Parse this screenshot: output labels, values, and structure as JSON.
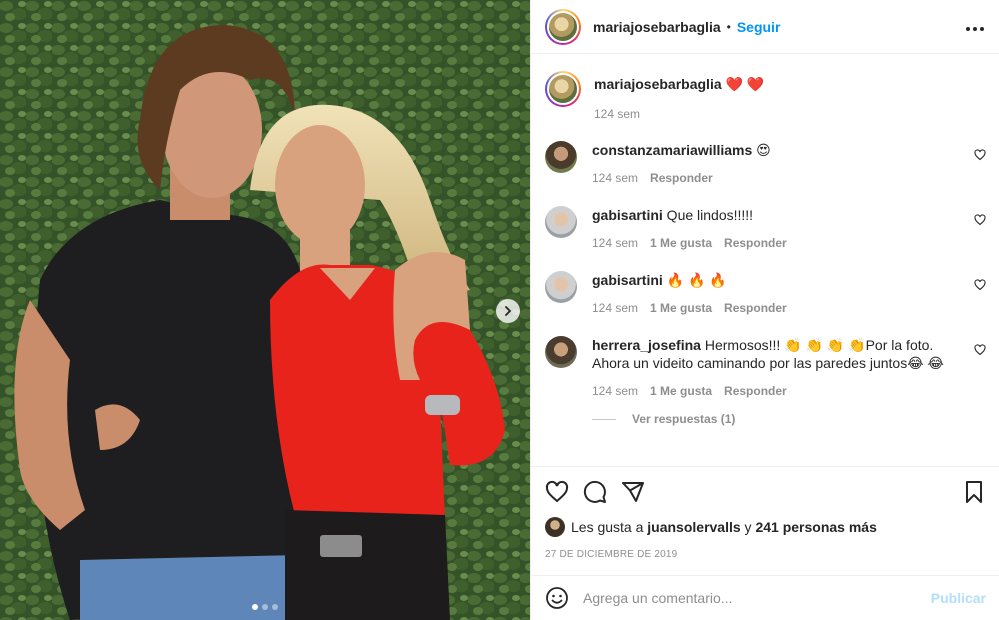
{
  "post": {
    "username": "mariajosebarbaglia",
    "separator": "•",
    "follow_label": "Seguir",
    "more_icon": "more-horizontal-icon",
    "carousel": {
      "next_icon": "chevron-right-icon",
      "slides": 3,
      "current": 1
    }
  },
  "caption": {
    "username": "mariajosebarbaglia",
    "text": " ❤️ ❤️",
    "time": "124 sem"
  },
  "comments": [
    {
      "username": "constanzamariawilliams",
      "text": " 😍",
      "time": "124 sem",
      "likes": "",
      "reply": "Responder"
    },
    {
      "username": "gabisartini",
      "text": " Que lindos!!!!!",
      "time": "124 sem",
      "likes": "1 Me gusta",
      "reply": "Responder"
    },
    {
      "username": "gabisartini",
      "text": " 🔥 🔥 🔥",
      "time": "124 sem",
      "likes": "1 Me gusta",
      "reply": "Responder"
    },
    {
      "username": "herrera_josefina",
      "text": " Hermosos!!! 👏 👏 👏 👏Por la foto. Ahora un videito caminando por las paredes juntos😂 😂",
      "time": "124 sem",
      "likes": "1 Me gusta",
      "reply": "Responder"
    }
  ],
  "view_replies": "Ver respuestas (1)",
  "likes": {
    "prefix": "Les gusta a ",
    "user": "juansolervalls",
    "connector": " y ",
    "others": "241 personas más"
  },
  "date": "27 DE DICIEMBRE DE 2019",
  "comment_input": {
    "placeholder": "Agrega un comentario...",
    "publish_label": "Publicar"
  },
  "icons": {
    "like": "heart-icon",
    "comment": "comment-icon",
    "share": "share-icon",
    "save": "bookmark-icon",
    "emoji": "smile-icon"
  },
  "colors": {
    "link": "#0095f6",
    "muted": "#8e8e8e",
    "heart_red": "#ed4956",
    "publish_disabled": "#b2dffc"
  }
}
